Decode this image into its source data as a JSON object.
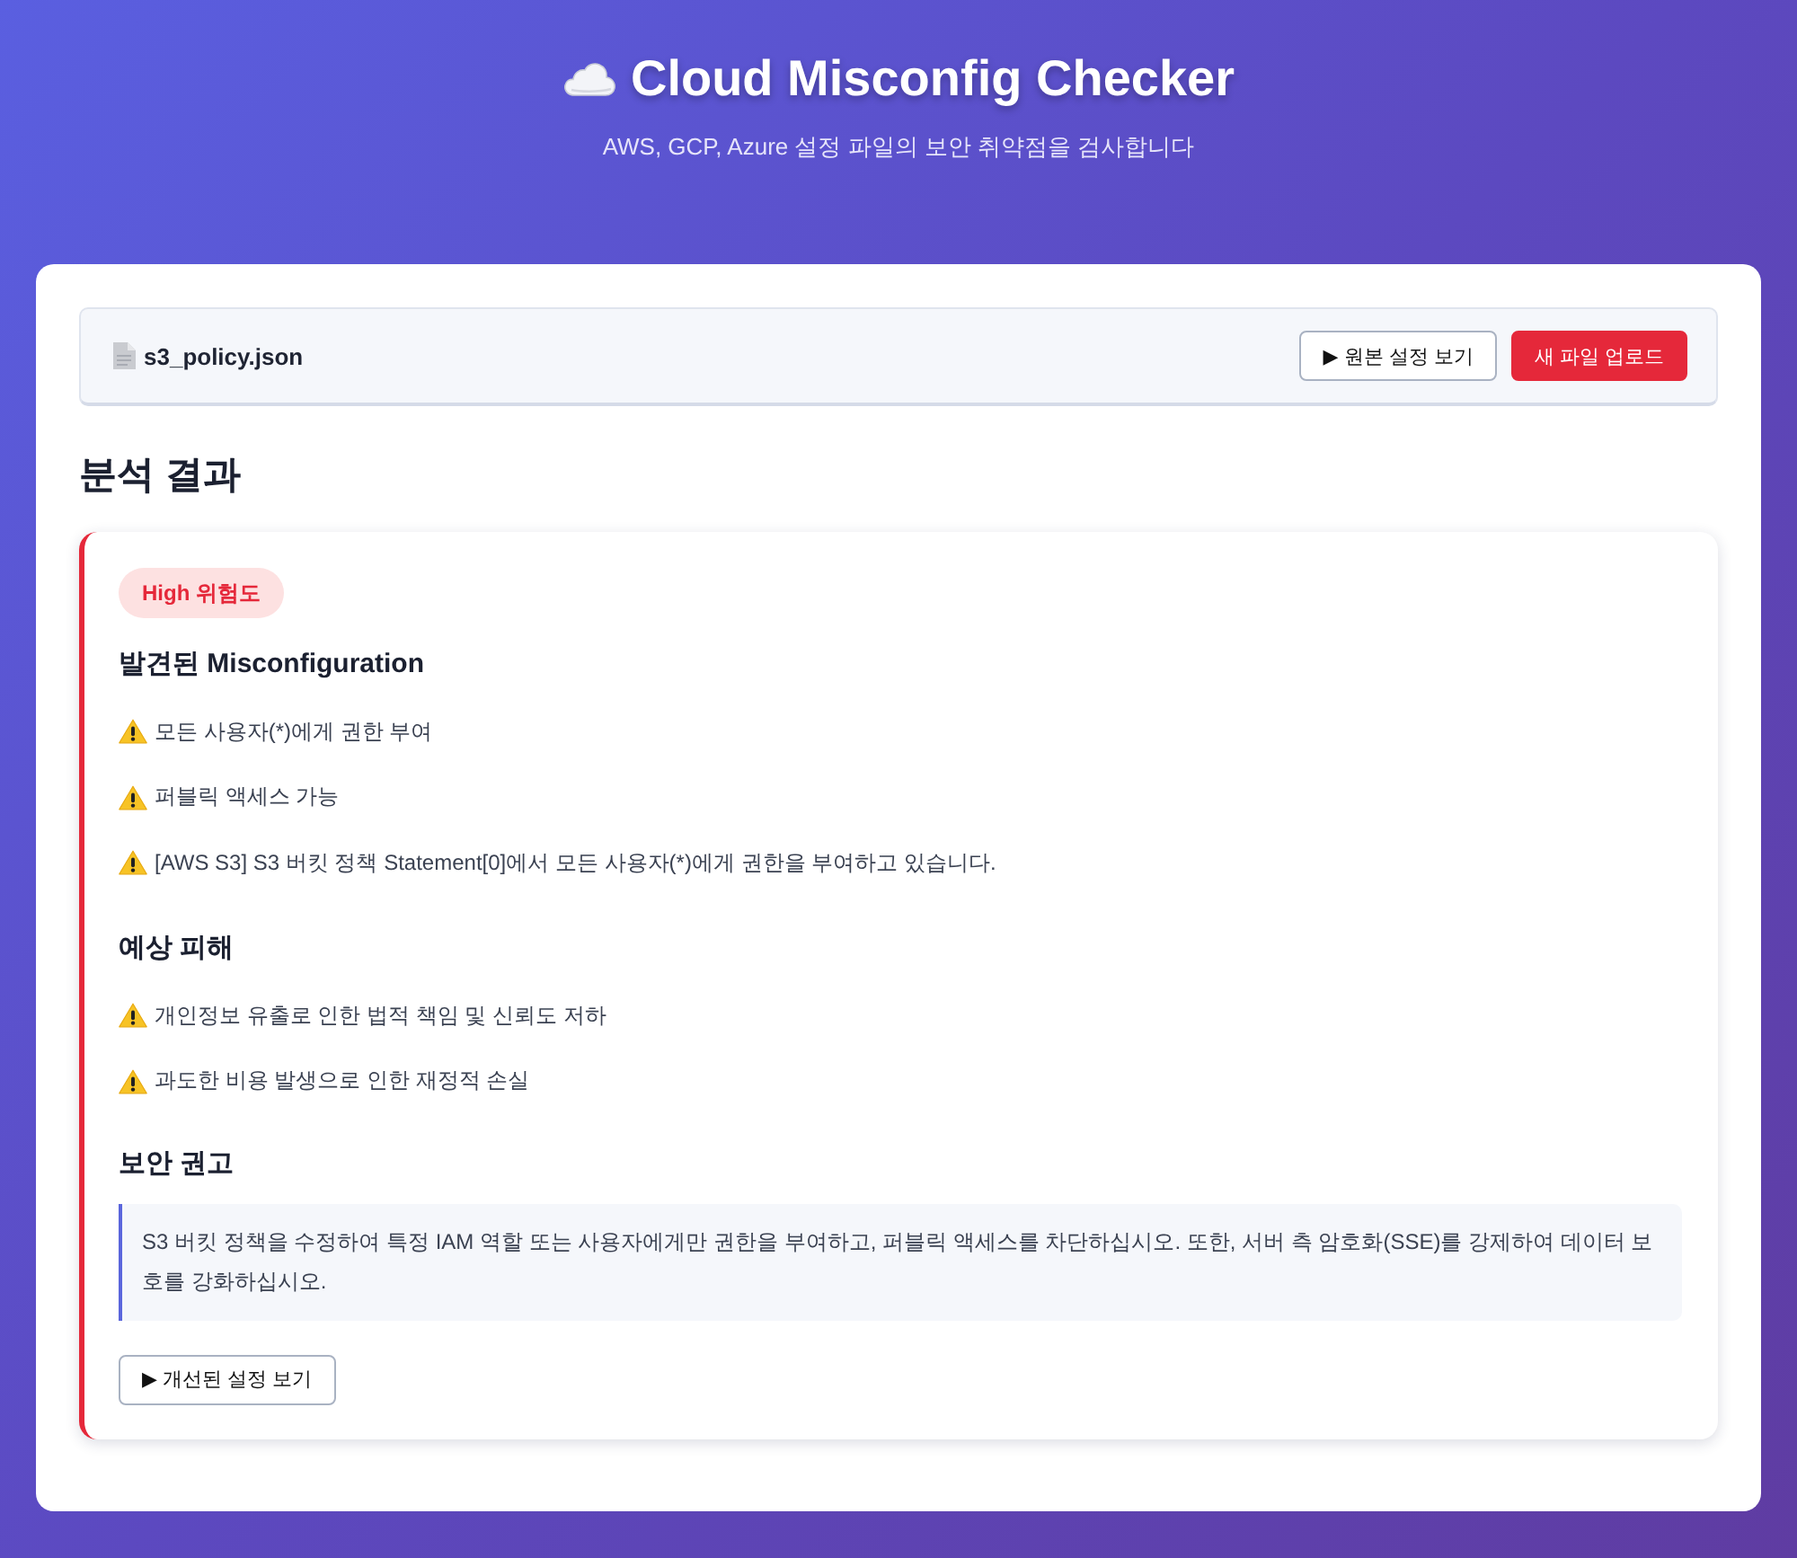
{
  "header": {
    "title": "Cloud Misconfig Checker",
    "subtitle": "AWS, GCP, Azure 설정 파일의 보안 취약점을 검사합니다"
  },
  "file_bar": {
    "filename": "s3_policy.json",
    "buttons": [
      {
        "label": "▶ 원본 설정 보기",
        "kind": "outline"
      },
      {
        "label": "새 파일 업로드",
        "kind": "primary"
      }
    ]
  },
  "results": {
    "title": "분석 결과",
    "badge": {
      "label": "High 위험도",
      "kind": "high"
    },
    "sections": [
      {
        "heading": "발견된 Misconfiguration",
        "kind": "list",
        "items": [
          "모든 사용자(*)에게 권한 부여",
          "퍼블릭 액세스 가능",
          "[AWS S3] S3 버킷 정책 Statement[0]에서 모든 사용자(*)에게 권한을 부여하고 있습니다."
        ]
      },
      {
        "heading": "예상 피해",
        "kind": "list",
        "items": [
          "개인정보 유출로 인한 법적 책임 및 신뢰도 저하",
          "과도한 비용 발생으로 인한 재정적 손실"
        ]
      },
      {
        "heading": "보안 권고",
        "kind": "note",
        "text": "S3 버킷 정책을 수정하여 특정 IAM 역할 또는 사용자에게만 권한을 부여하고, 퍼블릭 액세스를 차단하십시오. 또한, 서버 측 암호화(SSE)를 강제하여 데이터 보호를 강화하십시오."
      }
    ],
    "button": {
      "label": "▶ 개선된 설정 보기"
    }
  }
}
